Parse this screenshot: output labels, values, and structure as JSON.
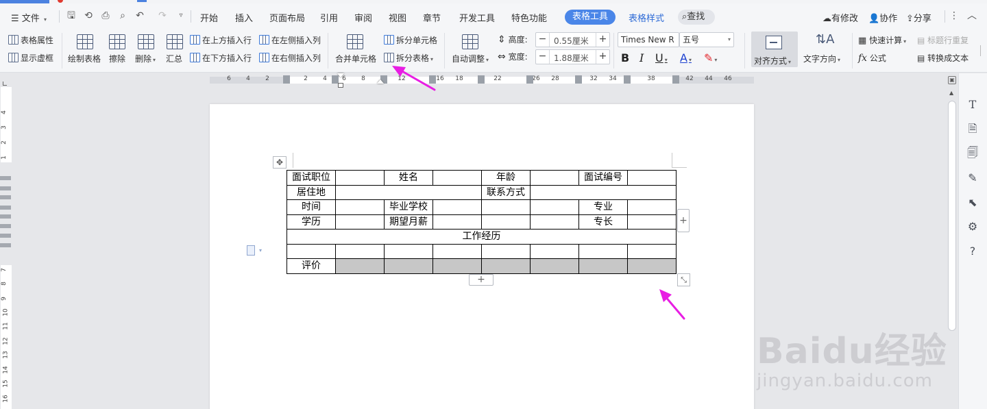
{
  "menubar": {
    "file_label": "文件",
    "tabs": [
      "开始",
      "插入",
      "页面布局",
      "引用",
      "审阅",
      "视图",
      "章节",
      "开发工具",
      "特色功能"
    ],
    "active_tab": "表格工具",
    "context_tab": "表格样式",
    "search_label": "查找",
    "right": [
      "有修改",
      "协作",
      "分享"
    ]
  },
  "ribbon": {
    "table_props": "表格属性",
    "show_gridlines": "显示虚框",
    "draw_table": "绘制表格",
    "erase": "擦除",
    "delete": "删除",
    "summary": "汇总",
    "insert_row_above": "在上方插入行",
    "insert_row_below": "在下方插入行",
    "insert_col_left": "在左侧插入列",
    "insert_col_right": "在右侧插入列",
    "merge_cells": "合并单元格",
    "split_cells": "拆分单元格",
    "split_table": "拆分表格",
    "auto_fit": "自动调整",
    "height_label": "高度:",
    "height_value": "0.55厘米",
    "width_label": "宽度:",
    "width_value": "1.88厘米",
    "font_name": "Times New R",
    "font_size": "五号",
    "align": "对齐方式",
    "text_direction": "文字方向",
    "quick_calc": "快速计算",
    "repeat_header": "标题行重复",
    "formula": "公式",
    "convert_to_text": "转换成文本"
  },
  "ruler": {
    "h_numbers": [
      "6",
      "4",
      "2",
      "2",
      "4",
      "6",
      "8",
      "12",
      "16",
      "18",
      "22",
      "26",
      "28",
      "32",
      "34",
      "38",
      "42",
      "44",
      "46"
    ],
    "v_numbers": [
      "4",
      "3",
      "2",
      "1",
      "7",
      "8",
      "9",
      "10",
      "11",
      "12",
      "13",
      "14",
      "15",
      "16"
    ]
  },
  "table": {
    "row1": [
      "面试职位",
      "",
      "姓名",
      "",
      "年龄",
      "",
      "面试编号",
      ""
    ],
    "row2_a": "居住地",
    "row2_b": "联系方式",
    "row3": [
      "时间",
      "",
      "毕业学校",
      "",
      "",
      "",
      "专业",
      ""
    ],
    "row4": [
      "学历",
      "",
      "期望月薪",
      "",
      "",
      "",
      "专长",
      ""
    ],
    "row5": "工作经历",
    "row7_label": "评价"
  },
  "colors": {
    "accent": "#4a86e8",
    "arrow": "#e81ee3",
    "selected_cell": "#c7c7c7"
  },
  "watermark": {
    "brand": "Baidu经验",
    "url": "jingyan.baidu.com"
  }
}
